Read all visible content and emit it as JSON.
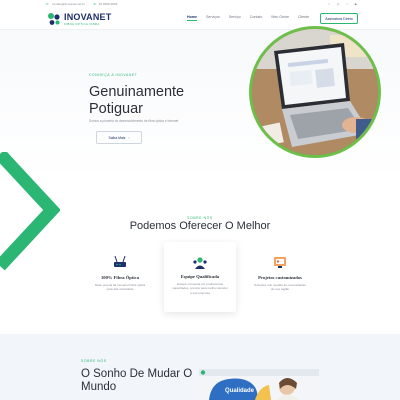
{
  "topbar": {
    "email": "contato@inovanet.net.br",
    "phone": "84 9999-9999",
    "social_icons": [
      "facebook-icon",
      "instagram-icon",
      "twitter-icon",
      "youtube-icon"
    ]
  },
  "logo": {
    "brand": "INOVANET",
    "tagline": "FIBRA OPTICA FIBRA"
  },
  "nav": {
    "items": [
      {
        "label": "Home",
        "active": true
      },
      {
        "label": "Serviços",
        "active": false
      },
      {
        "label": "Serviço",
        "active": false
      },
      {
        "label": "Contato",
        "active": false
      },
      {
        "label": "Meu Onine",
        "active": false
      },
      {
        "label": "Cliente",
        "active": false
      }
    ],
    "cta": "Assinatura Direto"
  },
  "hero": {
    "eyebrow": "CONHEÇA A INOVANET",
    "title": "Genuinamente Potiguar",
    "subtitle": "Somos a pioneira no desenvolvimento de fibra óptica e Internet",
    "button": "Saiba Mais"
  },
  "services": {
    "eyebrow": "SOBRE NÓS",
    "title": "Podemos Oferecer O Melhor",
    "cards": [
      {
        "icon": "router-icon",
        "title": "100% Fibra Óptica",
        "text": "Rede própria da Inovanet Fibra óptica para alta velocidade"
      },
      {
        "icon": "team-icon",
        "title": "Equipe Qualificada",
        "text": "Equipe composta por profissionais capacitados, prontos para melhor atender a sua empresa"
      },
      {
        "icon": "project-icon",
        "title": "Projetos customizados",
        "text": "Soluções sob medida às necessidades de sua região"
      }
    ]
  },
  "about": {
    "eyebrow": "SOBRE NÓS",
    "title": "O Sonho De Mudar O Mundo",
    "video_caption": "Qualidade"
  },
  "colors": {
    "accent": "#2bb673",
    "navy": "#1e2f6b",
    "lime_ring": "#6cc04a"
  }
}
